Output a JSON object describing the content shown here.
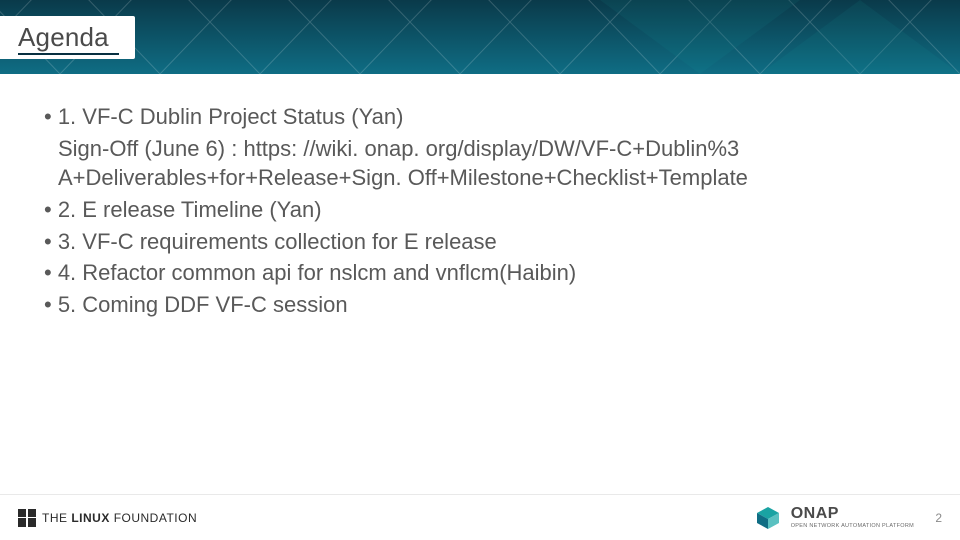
{
  "header": {
    "title": "Agenda"
  },
  "body": {
    "items": [
      "• 1. VF-C Dublin Project Status (Yan)",
      "   Sign-Off (June 6) : https: //wiki. onap. org/display/DW/VF-C+Dublin%3 A+Deliverables+for+Release+Sign. Off+Milestone+Checklist+Template",
      "• 2. E release Timeline (Yan)",
      "• 3. VF-C requirements collection for E release",
      "• 4. Refactor common api for nslcm and vnflcm(Haibin)",
      "• 5. Coming DDF VF-C session"
    ]
  },
  "footer": {
    "linux_the": "THE",
    "linux_linux": "LINUX",
    "linux_foundation": "FOUNDATION",
    "onap_main": "ONAP",
    "onap_sub": "OPEN NETWORK AUTOMATION PLATFORM",
    "page": "2"
  }
}
